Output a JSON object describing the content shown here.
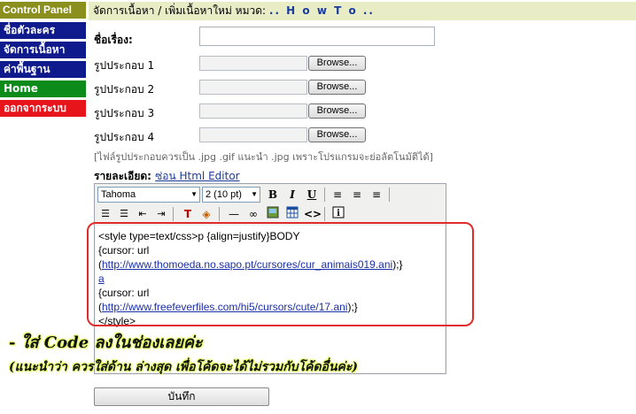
{
  "sidebar": {
    "header": "Control Panel",
    "items": [
      {
        "label": "ชื่อตัวละคร",
        "color": "#0f1b8c"
      },
      {
        "label": "จัดการเนื้อหา",
        "color": "#0f1b8c"
      },
      {
        "label": "ค่าพื้นฐาน",
        "color": "#0f1b8c"
      },
      {
        "label": "Home",
        "color": "#0c8a1a"
      },
      {
        "label": "ออกจากระบบ",
        "color": "#e8141c"
      }
    ]
  },
  "header": {
    "prefix": "จัดการเนื้อหา / เพิ่มเนื้อหาใหม่ หมวด: ",
    "category": ".. H o w T o .."
  },
  "form": {
    "title_label": "ชื่อเรื่อง:",
    "title_value": "",
    "images": [
      {
        "label": "รูปประกอบ 1",
        "button": "Browse..."
      },
      {
        "label": "รูปประกอบ 2",
        "button": "Browse..."
      },
      {
        "label": "รูปประกอบ 3",
        "button": "Browse..."
      },
      {
        "label": "รูปประกอบ 4",
        "button": "Browse..."
      }
    ],
    "hint": "[ไฟล์รูปประกอบควรเป็น .jpg .gif แนะนำ .jpg เพราะโปรแกรมจะย่อลัตโนมัติได้]",
    "detail_label": "รายละเอียด:",
    "detail_link": "ซ่อน Html Editor",
    "save_button": "บันทึก"
  },
  "editor": {
    "font": "Tahoma",
    "size": "2 (10 pt)",
    "toolbar_icons": [
      "bold-icon",
      "italic-icon",
      "underline-icon",
      "align-left-icon",
      "align-center-icon",
      "align-right-icon",
      "ordered-list-icon",
      "unordered-list-icon",
      "outdent-icon",
      "indent-icon",
      "text-color-icon",
      "background-color-icon",
      "horizontal-rule-icon",
      "link-icon",
      "image-icon",
      "table-icon",
      "html-source-icon",
      "info-icon"
    ],
    "code_lines": {
      "l1": "<style type=text/css>p {align=justify}BODY",
      "l2": "{cursor: url",
      "l3_open": "(",
      "l3_link": "http://www.thomoeda.no.sapo.pt/cursores/cur_animais019.ani",
      "l3_close": ");}",
      "l4": "a",
      "l5": "{cursor: url",
      "l6_open": "(",
      "l6_link": "http://www.freefeverfiles.com/hi5/cursors/cute/17.ani",
      "l6_close": ");}",
      "l7": "</style>"
    }
  },
  "annotation": {
    "line1": "- ใส่ Code ลงในช่องเลยค่ะ",
    "line2": "(แนะนำว่า ควรใส่ด้าน ล่างสุด เพื่อโค้ดจะได้ไม่รวมกับโค้ดอื่นค่ะ)",
    "highlight_color": "#e12a2a"
  }
}
